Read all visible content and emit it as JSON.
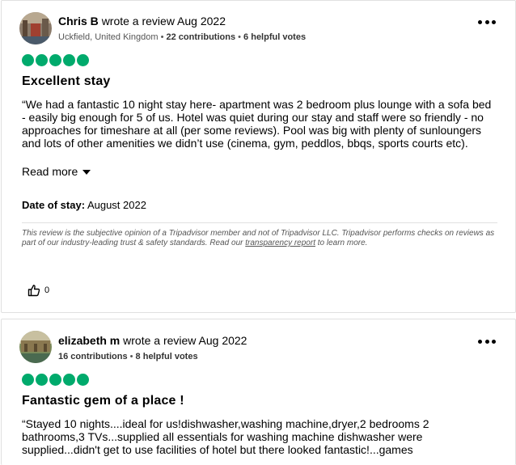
{
  "reviews": [
    {
      "user": "Chris B",
      "action": "wrote a review Aug 2022",
      "location": "Uckfield, United Kingdom",
      "contributions_count": "22 contributions",
      "helpful_votes": "6 helpful votes",
      "rating": 5,
      "title": "Excellent stay",
      "body": "“We had a fantastic 10 night stay here- apartment was 2 bedroom plus lounge with a sofa bed - easily big enough for 5 of us. Hotel was quiet during our stay and staff were so friendly - no approaches for timeshare at all (per some reviews). Pool was big with plenty of sunloungers and lots of other amenities we didn’t use (cinema, gym, peddlos, bbqs, sports courts etc).",
      "read_more": "Read more",
      "date_of_stay_label": "Date of stay:",
      "date_of_stay": "August 2022",
      "disclaimer": "This review is the subjective opinion of a Tripadvisor member and not of Tripadvisor LLC. Tripadvisor performs checks on reviews as part of our industry-leading trust & safety standards. Read our",
      "disclaimer_link": "transparency report",
      "disclaimer_end": "to learn more.",
      "helpful_count": "0"
    },
    {
      "user": "elizabeth m",
      "action": "wrote a review Aug 2022",
      "contributions_count": "16 contributions",
      "helpful_votes": "8 helpful votes",
      "rating": 5,
      "title": "Fantastic gem of a place !",
      "body": "“Stayed 10 nights....ideal for us!dishwasher,washing machine,dryer,2 bedrooms 2 bathrooms,3 TVs...supplied all essentials for washing machine dishwasher were supplied...didn't get to use facilities of hotel but there looked fantastic!...games"
    }
  ],
  "colors": {
    "bubble": "#00aa6c",
    "border": "#e0e0e0"
  },
  "icons": {
    "more": "more-options-icon",
    "thumbs": "thumbs-up-icon",
    "caret": "caret-down-icon"
  }
}
